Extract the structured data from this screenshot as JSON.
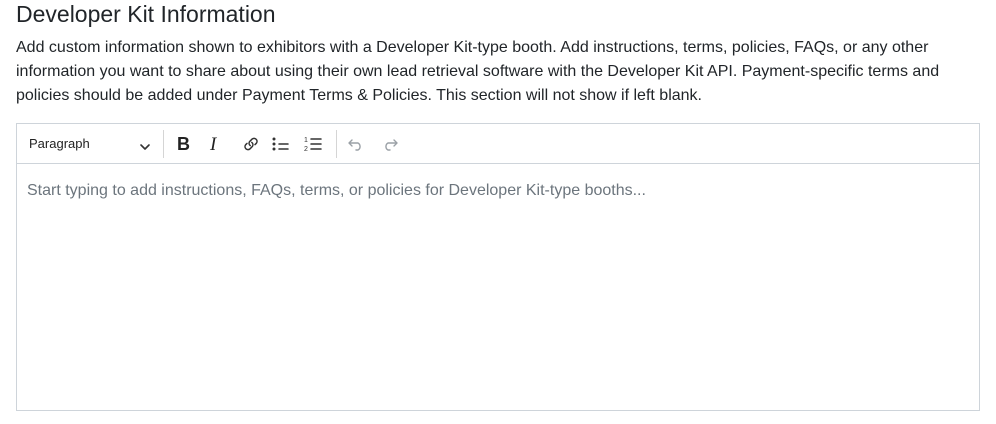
{
  "section": {
    "title": "Developer Kit Information",
    "description": "Add custom information shown to exhibitors with a Developer Kit-type booth. Add instructions, terms, policies, FAQs, or any other information you want to share about using their own lead retrieval software with the Developer Kit API. Payment-specific terms and policies should be added under Payment Terms & Policies. This section will not show if left blank."
  },
  "editor": {
    "block_format": "Paragraph",
    "placeholder": "Start typing to add instructions, FAQs, terms, or policies for Developer Kit-type booths...",
    "toolbar_icons": [
      "bold-icon",
      "italic-icon",
      "link-icon",
      "bulleted-list-icon",
      "numbered-list-icon",
      "undo-icon",
      "redo-icon"
    ],
    "colors": {
      "border": "#ced4da",
      "icon": "#333333",
      "icon_disabled": "#9aa0a6",
      "placeholder": "#6c757d"
    }
  }
}
